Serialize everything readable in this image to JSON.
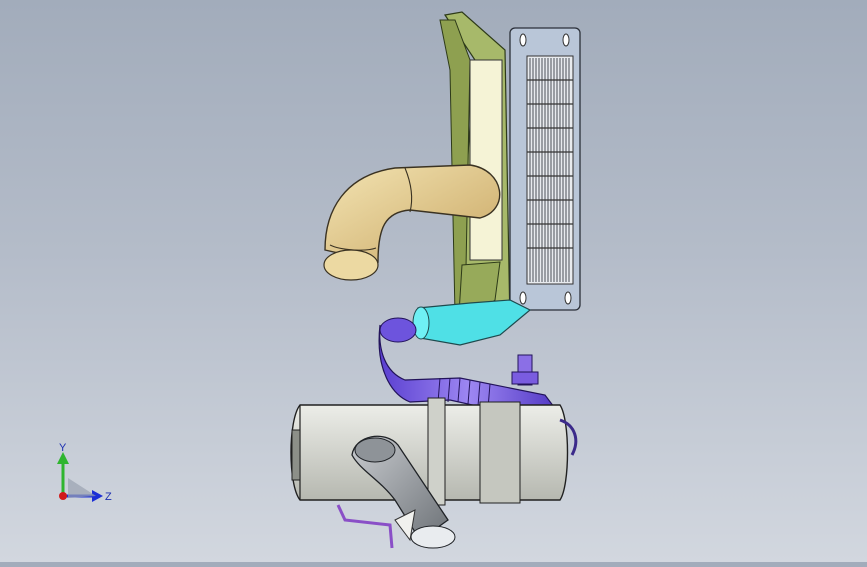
{
  "viewport": {
    "background_top": "#a2acbb",
    "background_bottom": "#d2d7df"
  },
  "triad": {
    "y_label": "Y",
    "z_label": "Z",
    "y_color": "#2fb52f",
    "z_color": "#1c2fd6",
    "x_color": "#d11a1a"
  },
  "model": {
    "radiator_frame_color": "#b9c6d8",
    "radiator_fin_color": "#e6e9ee",
    "support_color": "#a6b86a",
    "elbow_color": "#e6d39a",
    "connector_color": "#4fe0e6",
    "hose_color": "#7a5ce0",
    "tank_color": "#d9dad4",
    "outlet_color": "#9ea3a8",
    "bracket_color": "#8a4fc7"
  }
}
